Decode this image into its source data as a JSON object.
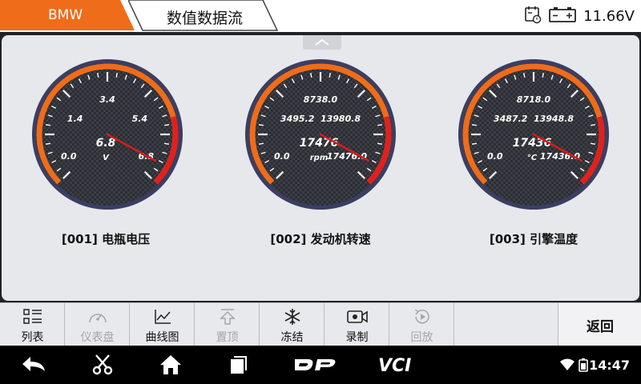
{
  "header": {
    "brand": "BMW",
    "title": "数值数据流",
    "battery_voltage": "11.66V"
  },
  "colors": {
    "accent": "#ef6c1a",
    "needle": "#d81b1b",
    "redline": "#e0211e"
  },
  "gauges": [
    {
      "caption": "[001] 电瓶电压",
      "value": "6.8",
      "unit": "V",
      "scale_labels": {
        "min": "0.0",
        "low": "1.4",
        "top": "3.4",
        "high": "5.4",
        "max": "6.8"
      },
      "needle_fraction": 0.94
    },
    {
      "caption": "[002] 发动机转速",
      "value": "17476",
      "unit": "rpm",
      "scale_labels": {
        "min": "0.0",
        "low": "3495.2",
        "top": "8738.0",
        "high": "13980.8",
        "max": "17476.0"
      },
      "needle_fraction": 0.94
    },
    {
      "caption": "[003] 引擎温度",
      "value": "17436",
      "unit": "°C",
      "scale_labels": {
        "min": "0.0",
        "low": "3487.2",
        "top": "8718.0",
        "high": "13948.8",
        "max": "17436.0"
      },
      "needle_fraction": 0.94
    }
  ],
  "toolbar": {
    "items": [
      {
        "label": "列表",
        "icon": "list-icon",
        "enabled": true
      },
      {
        "label": "仪表盘",
        "icon": "gauge-icon",
        "enabled": false
      },
      {
        "label": "曲线图",
        "icon": "line-chart-icon",
        "enabled": true
      },
      {
        "label": "置顶",
        "icon": "pin-top-icon",
        "enabled": false
      },
      {
        "label": "冻结",
        "icon": "snowflake-icon",
        "enabled": true
      },
      {
        "label": "录制",
        "icon": "video-record-icon",
        "enabled": true
      },
      {
        "label": "回放",
        "icon": "playback-icon",
        "enabled": false
      }
    ],
    "back_label": "返回"
  },
  "navbar": {
    "time": "14:47",
    "logos": [
      "DP",
      "VCI"
    ]
  }
}
